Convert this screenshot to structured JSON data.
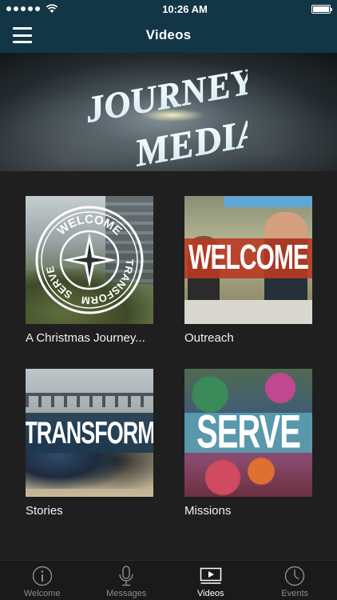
{
  "status_bar": {
    "time": "10:26 AM"
  },
  "nav": {
    "title": "Videos",
    "menu_icon": "hamburger-menu-icon"
  },
  "banner": {
    "logo_line1": "JOURNEY",
    "logo_line2": "MEDIA"
  },
  "videos": [
    {
      "caption": "A Christmas Journey...",
      "thumb_text": "WELCOME TRANSFORM SERVE"
    },
    {
      "caption": "Outreach",
      "thumb_text": "WELCOME"
    },
    {
      "caption": "Stories",
      "thumb_text": "TRANSFORM"
    },
    {
      "caption": "Missions",
      "thumb_text": "SERVE"
    }
  ],
  "thumb_words": {
    "welcome": "WELCOME",
    "transform": "TRANSFORM",
    "serve": "SERVE"
  },
  "tabs": [
    {
      "label": "Welcome",
      "icon": "info-icon",
      "active": false
    },
    {
      "label": "Messages",
      "icon": "microphone-icon",
      "active": false
    },
    {
      "label": "Videos",
      "icon": "video-player-icon",
      "active": true
    },
    {
      "label": "Events",
      "icon": "clock-icon",
      "active": false
    }
  ],
  "colors": {
    "nav_bg": "#123646",
    "content_bg": "#1f1f1f",
    "welcome_band": "#b83a22",
    "transform_band": "#1e3a50",
    "serve_band": "#5aa0b2"
  }
}
